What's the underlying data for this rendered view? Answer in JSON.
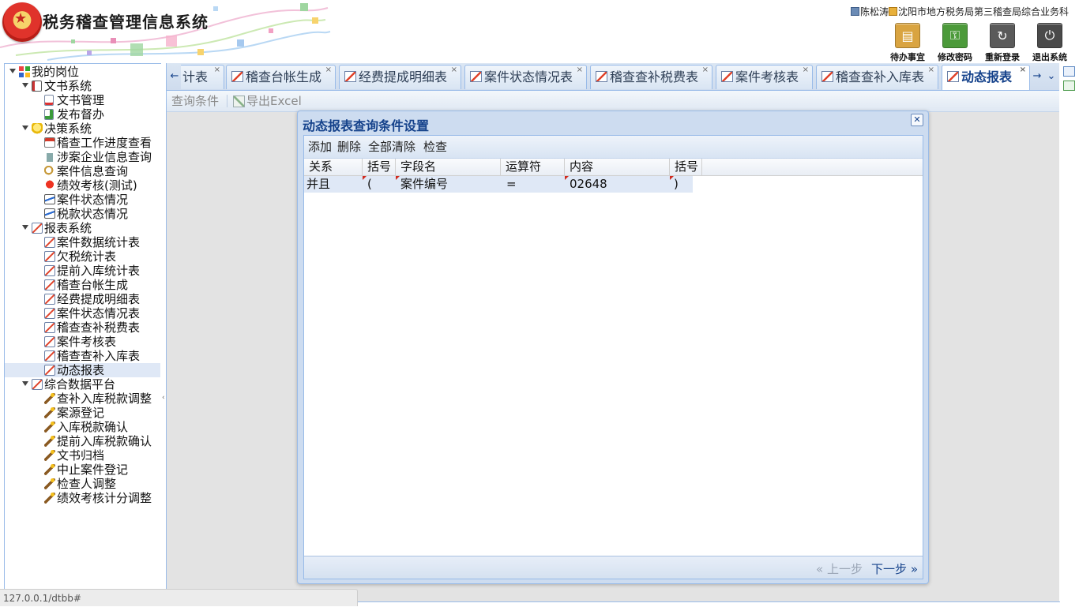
{
  "header": {
    "app_title": "税务稽查管理信息系统",
    "user_name": "陈松涛",
    "org_name": "沈阳市地方税务局第三稽查局综合业务科",
    "buttons": [
      {
        "label": "待办事宜",
        "icon": "todo-clipboard-icon",
        "color": "#d9a441"
      },
      {
        "label": "修改密码",
        "icon": "key-icon",
        "color": "#4c9a3a"
      },
      {
        "label": "重新登录",
        "icon": "relogin-icon",
        "color": "#5a5a5a"
      },
      {
        "label": "退出系统",
        "icon": "power-icon",
        "color": "#4a4a4a"
      }
    ]
  },
  "tree": {
    "root": "我的岗位",
    "groups": [
      {
        "label": "文书系统",
        "items": [
          "文书管理",
          "发布督办"
        ]
      },
      {
        "label": "决策系统",
        "items": [
          "稽查工作进度查看",
          "涉案企业信息查询",
          "案件信息查询",
          "绩效考核(测试)",
          "案件状态情况",
          "税款状态情况"
        ]
      },
      {
        "label": "报表系统",
        "items": [
          "案件数据统计表",
          "欠税统计表",
          "提前入库统计表",
          "稽查台帐生成",
          "经费提成明细表",
          "案件状态情况表",
          "稽查查补税费表",
          "案件考核表",
          "稽查查补入库表",
          "动态报表"
        ]
      },
      {
        "label": "综合数据平台",
        "items": [
          "查补入库税款调整",
          "案源登记",
          "入库税款确认",
          "提前入库税款确认",
          "文书归档",
          "中止案件登记",
          "检查人调整",
          "绩效考核计分调整"
        ]
      }
    ],
    "selected": "动态报表"
  },
  "tabs": [
    {
      "label": "计表",
      "active": false
    },
    {
      "label": "稽查台帐生成",
      "active": false
    },
    {
      "label": "经费提成明细表",
      "active": false
    },
    {
      "label": "案件状态情况表",
      "active": false
    },
    {
      "label": "稽查查补税费表",
      "active": false
    },
    {
      "label": "案件考核表",
      "active": false
    },
    {
      "label": "稽查查补入库表",
      "active": false
    },
    {
      "label": "动态报表",
      "active": true
    }
  ],
  "toolbar": {
    "query_condition": "查询条件",
    "export_excel": "导出Excel"
  },
  "dialog": {
    "title": "动态报表查询条件设置",
    "actions": {
      "add": "添加",
      "delete": "删除",
      "clear_all": "全部清除",
      "check": "检查"
    },
    "columns": [
      "关系",
      "括号",
      "字段名",
      "运算符",
      "内容",
      "括号"
    ],
    "rows": [
      {
        "relation": "并且",
        "open_paren": "(",
        "field": "案件编号",
        "operator": "=",
        "content": "02648",
        "close_paren": ")"
      }
    ],
    "prev_step": "« 上一步",
    "next_step": "下一步 »"
  },
  "status_url": "127.0.0.1/dtbb#",
  "colors": {
    "accent": "#15428b",
    "border": "#99bbe8",
    "selected_row": "#dfe8f6",
    "dirty_marker": "#d02a1e"
  }
}
